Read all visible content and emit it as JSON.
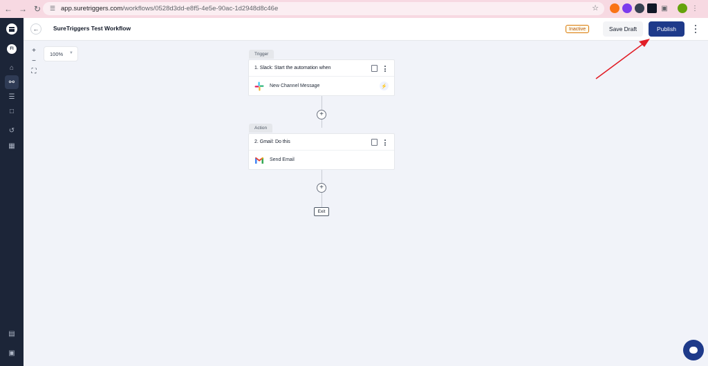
{
  "browser": {
    "url_host": "app.suretriggers.com",
    "url_path": "/workflows/0528d3dd-e8f5-4e5e-90ac-1d2948d8c46e"
  },
  "sidebar": {
    "avatar_initials": "FI"
  },
  "header": {
    "title": "SureTriggers Test Workflow",
    "status": "Inactive",
    "save_draft_label": "Save Draft",
    "publish_label": "Publish"
  },
  "canvas": {
    "zoom_level": "100%",
    "zoom_in_symbol": "+",
    "zoom_out_symbol": "−"
  },
  "trigger": {
    "tag": "Trigger",
    "title": "1. Slack: Start the automation when",
    "action": "New Channel Message",
    "icon": "slack-icon"
  },
  "action": {
    "tag": "Action",
    "title": "2. Gmail: Do this",
    "action": "Send Email",
    "icon": "gmail-icon"
  },
  "flow": {
    "add_symbol": "+",
    "exit_label": "Exit"
  },
  "colors": {
    "primary": "#1e3a8a",
    "sidebar": "#1c2538",
    "inactive_badge": "#d97706",
    "annotation_arrow": "#e11d26"
  }
}
